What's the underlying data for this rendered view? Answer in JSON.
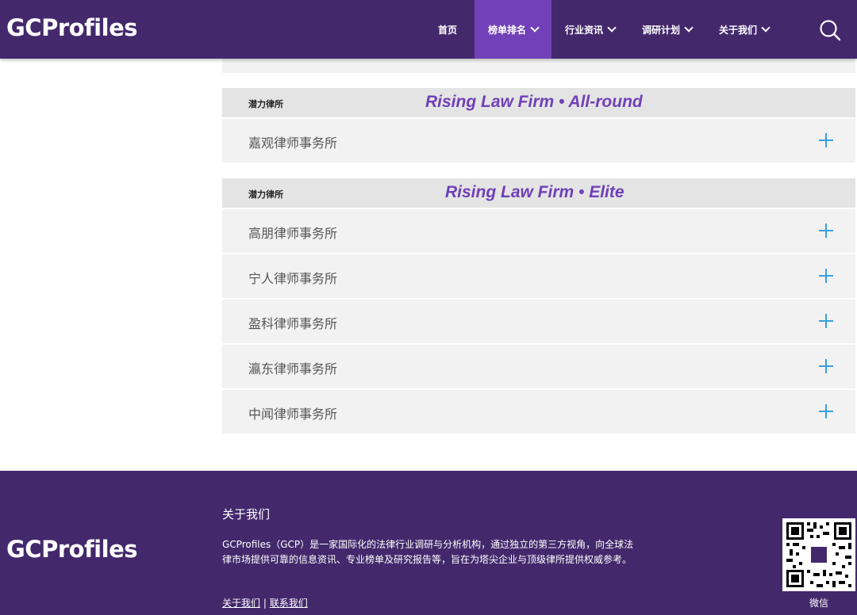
{
  "header": {
    "logo": "GCProfiles",
    "nav": [
      {
        "label": "首页"
      },
      {
        "label": "榜单排名"
      },
      {
        "label": "行业资讯"
      },
      {
        "label": "调研计划"
      },
      {
        "label": "关于我们"
      }
    ],
    "search_icon": "search-icon"
  },
  "sections": [
    {
      "label": "潜力律所",
      "title": "Rising Law Firm • All-round",
      "firms": [
        "嘉观律师事务所"
      ]
    },
    {
      "label": "潜力律所",
      "title": "Rising Law Firm • Elite",
      "firms": [
        "高朋律师事务所",
        "宁人律师事务所",
        "盈科律师事务所",
        "瀛东律师事务所",
        "中闻律师事务所"
      ]
    }
  ],
  "footer": {
    "logo": "GCProfiles",
    "about_title": "关于我们",
    "description": "GCProfiles（GCP）是一家国际化的法律行业调研与分析机构，通过独立的第三方视角，向全球法律市场提供可靠的信息资讯、专业榜单及研究报告等，旨在为塔尖企业与顶级律所提供权威参考。",
    "link_about": "关于我们",
    "separator": "|",
    "link_contact": "联系我们",
    "qr_label": "微信"
  },
  "colors": {
    "header_bg": "#44286c",
    "nav_active": "#7240b8",
    "accent_title": "#7040b8",
    "plus": "#3aa0e0"
  }
}
